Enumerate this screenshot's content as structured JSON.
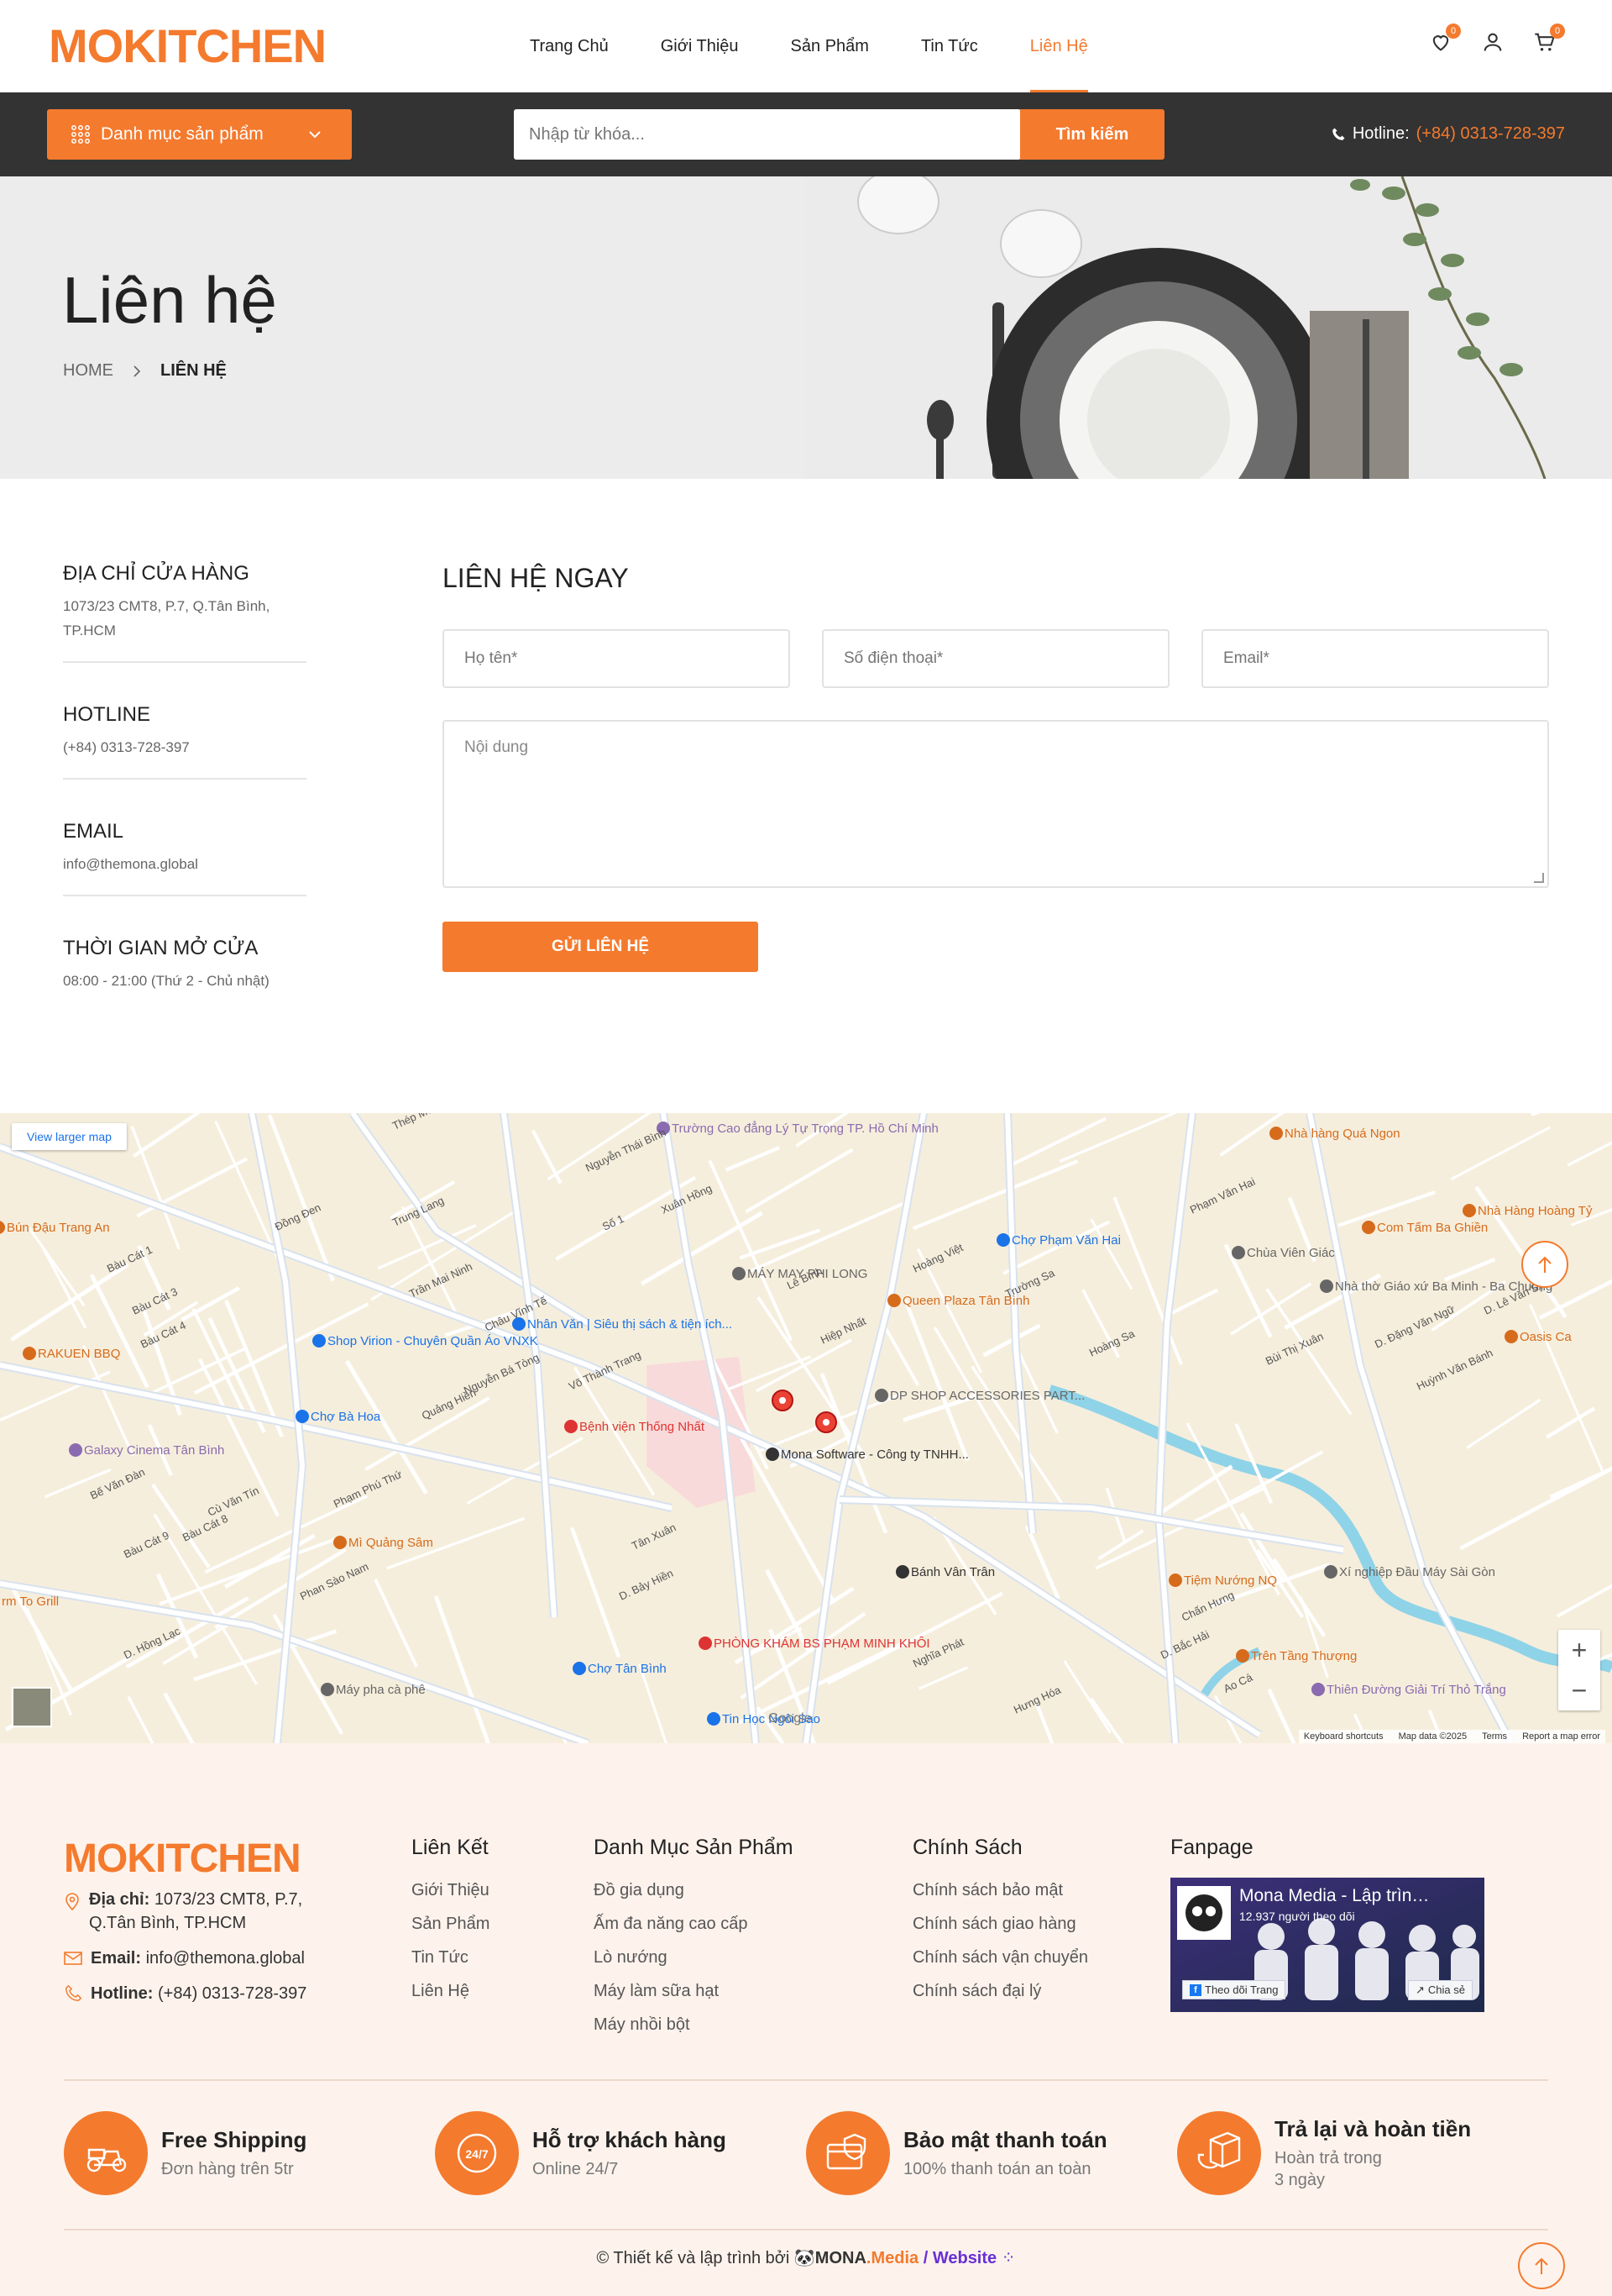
{
  "brand": {
    "logo": "MOKITCHEN",
    "accent": "#f47a2e"
  },
  "nav": {
    "items": [
      {
        "label": "Trang Chủ",
        "active": false
      },
      {
        "label": "Giới Thiệu",
        "active": false
      },
      {
        "label": "Sản Phẩm",
        "active": false
      },
      {
        "label": "Tin Tức",
        "active": false
      },
      {
        "label": "Liên Hệ",
        "active": true
      }
    ]
  },
  "header_icons": {
    "wishlist_count": "0",
    "cart_count": "0"
  },
  "toolbar": {
    "category_label": "Danh mục sản phẩm",
    "search_placeholder": "Nhập từ khóa...",
    "search_button": "Tìm kiếm",
    "hotline_label": "Hotline:",
    "hotline_number": "(+84) 0313-728-397"
  },
  "banner": {
    "title": "Liên hệ",
    "crumb_home": "HOME",
    "crumb_current": "LIÊN HỆ"
  },
  "contact_info": [
    {
      "title": "ĐỊA CHỈ CỬA HÀNG",
      "text": "1073/23 CMT8, P.7, Q.Tân Bình, TP.HCM"
    },
    {
      "title": "HOTLINE",
      "text": "(+84) 0313-728-397"
    },
    {
      "title": "EMAIL",
      "text": "info@themona.global"
    },
    {
      "title": "THỜI GIAN MỞ CỬA",
      "text": "08:00 - 21:00 (Thứ 2 - Chủ nhật)"
    }
  ],
  "form": {
    "title": "LIÊN HỆ NGAY",
    "name_placeholder": "Họ tên*",
    "phone_placeholder": "Số điện thoại*",
    "email_placeholder": "Email*",
    "message_placeholder": "Nội dung",
    "submit": "GỬI LIÊN HỆ"
  },
  "map": {
    "larger_map": "View larger map",
    "footer_links": [
      "Keyboard shortcuts",
      "Map data ©2025",
      "Terms",
      "Report a map error"
    ],
    "places": [
      "Trường Cao đẳng Lý Tự Trọng TP. Hồ Chí Minh",
      "Nhà hàng Quá Ngon",
      "Bún Đậu Trang An",
      "MÁY MAY PHI LONG",
      "Chợ Phạm Văn Hai",
      "Chùa Viên Giác",
      "Com Tấm Ba Ghiền",
      "Nhà Hàng Hoàng Tỷ",
      "Nhân Văn | Siêu thị sách & tiện ích...",
      "Shop Virion - Chuyên Quần Áo VNXK",
      "RAKUEN BBQ",
      "Queen Plaza Tân Bình",
      "Nhà thờ Giáo xứ Ba Minh - Ba Chuông",
      "Oasis Ca",
      "Chợ Bà Hoa",
      "Bệnh viện Thống Nhất",
      "DP SHOP ACCESSORIES PART...",
      "Mona Software - Công ty TNHH...",
      "Galaxy Cinema Tân Bình",
      "Mì Quảng Sâm",
      "Bánh Vân Trân",
      "Tiệm Nướng NQ",
      "Xí nghiệp Đầu Máy Sài Gòn",
      "PHÒNG KHÁM BS PHẠM MINH KHÔI",
      "Chợ Tân Bình",
      "Trên Tầng Thượng",
      "Thiên Đường Giải Trí Thỏ Trắng",
      "Máy pha cà phê",
      "Tin Học Ngôi Sao",
      "rm To Grill"
    ],
    "streets": [
      "Thép Mới",
      "Nguyễn Thái Bình",
      "Xuân Hồng",
      "Lê Bình",
      "Hoàng Việt",
      "Trường Sa",
      "Hoàng Sa",
      "Bàu Cát 1",
      "Bàu Cát 3",
      "Bàu Cát 4",
      "Đồng Đen",
      "Võ Thành Trang",
      "Phạm Văn Hai",
      "Bùi Thị Xuân",
      "Phạm Phú Thứ",
      "Phan Sào Nam",
      "Cù Văn Tín",
      "Bế Văn Đàn",
      "Bàu Cát 8",
      "Bàu Cát 9",
      "D. Hồng Lạc",
      "D. Bảy Hiền",
      "Tân Xuân",
      "Nghĩa Phát",
      "Hưng Hóa",
      "D. Bắc Hải",
      "Chấn Hưng",
      "Ao Cá",
      "Huỳnh Văn Bánh",
      "D. Đặng Văn Ngữ",
      "D. Lê Văn Sỹ",
      "Quảng Hiền",
      "Nguyễn Bá Tòng",
      "Hiệp Nhất",
      "Trung Lang",
      "Trần Mai Ninh",
      "Châu Vĩnh Tế",
      "Số 1"
    ],
    "marker_label": "Mona Software - Công ty TNHH..."
  },
  "footer": {
    "logo": "MOKITCHEN",
    "address_label": "Địa chỉ:",
    "address": "1073/23 CMT8, P.7, Q.Tân Bình, TP.HCM",
    "email_label": "Email:",
    "email": "info@themona.global",
    "hotline_label": "Hotline:",
    "hotline": "(+84) 0313-728-397",
    "col1": {
      "title": "Liên Kết",
      "links": [
        "Giới Thiệu",
        "Sản Phẩm",
        "Tin Tức",
        "Liên Hệ"
      ]
    },
    "col2": {
      "title": "Danh Mục Sản Phẩm",
      "links": [
        "Đồ gia dụng",
        "Ấm đa năng cao cấp",
        "Lò nướng",
        "Máy làm sữa hạt",
        "Máy nhồi bột"
      ]
    },
    "col3": {
      "title": "Chính Sách",
      "links": [
        "Chính sách bảo mật",
        "Chính sách giao hàng",
        "Chính sách vận chuyển",
        "Chính sách đại lý"
      ]
    },
    "fanpage": {
      "title": "Fanpage",
      "page_name": "Mona Media - Lập trìn…",
      "followers": "12.937 người theo dõi",
      "follow": "Theo dõi Trang",
      "share": "Chia sẻ"
    },
    "features": [
      {
        "title": "Free Shipping",
        "sub": "Đơn hàng trên 5tr"
      },
      {
        "title": "Hỗ trợ khách hàng",
        "sub": "Online 24/7"
      },
      {
        "title": "Bảo mật thanh toán",
        "sub": "100% thanh toán an toàn"
      },
      {
        "title": "Trả lại và hoàn tiền",
        "sub": "Hoàn trả trong 3 ngày"
      }
    ],
    "copyright_text": "© Thiết kế và lập trình bởi",
    "copyright_brand": "MONA",
    "copyright_media": ".Media",
    "copyright_site": "/ Website"
  }
}
